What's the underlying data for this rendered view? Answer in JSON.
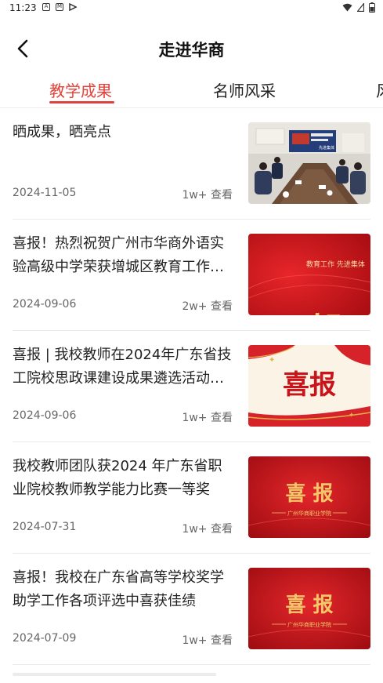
{
  "status": {
    "time": "11:23"
  },
  "header": {
    "title": "走进华商"
  },
  "tabs": [
    {
      "label": "教学成果",
      "active": true
    },
    {
      "label": "名师风采",
      "active": false
    },
    {
      "label": "风",
      "active": false
    }
  ],
  "articles": [
    {
      "title": "晒成果，晒亮点",
      "date": "2024-11-05",
      "views": "1w+ 查看",
      "thumb": {
        "type": "photo",
        "screen_text": "先进集体"
      }
    },
    {
      "title": "喜报！热烈祝贺广州市华商外语实验高级中学荣获增城区教育工作先进集体",
      "date": "2024-09-06",
      "views": "2w+ 查看",
      "thumb": {
        "type": "red",
        "big": "贺报",
        "small": "教育工作 先进集体"
      }
    },
    {
      "title": "喜报 | 我校教师在2024年广东省技工院校思政课建设成果遴选活动中获奖",
      "date": "2024-09-06",
      "views": "1w+ 查看",
      "thumb": {
        "type": "cream",
        "big": "喜报"
      }
    },
    {
      "title": "我校教师团队获2024 年广东省职业院校教师教学能力比赛一等奖",
      "date": "2024-07-31",
      "views": "1w+ 查看",
      "thumb": {
        "type": "red2",
        "big": "喜 报",
        "small": "广州华商职业学院"
      }
    },
    {
      "title": "喜报！我校在广东省高等学校奖学助学工作各项评选中喜获佳绩",
      "date": "2024-07-09",
      "views": "1w+ 查看",
      "thumb": {
        "type": "red2",
        "big": "喜 报",
        "small": "广州华商职业学院"
      }
    }
  ],
  "colors": {
    "accent": "#e0433c",
    "thumb_red": "#c8141a",
    "gold": "#f2c76a"
  }
}
